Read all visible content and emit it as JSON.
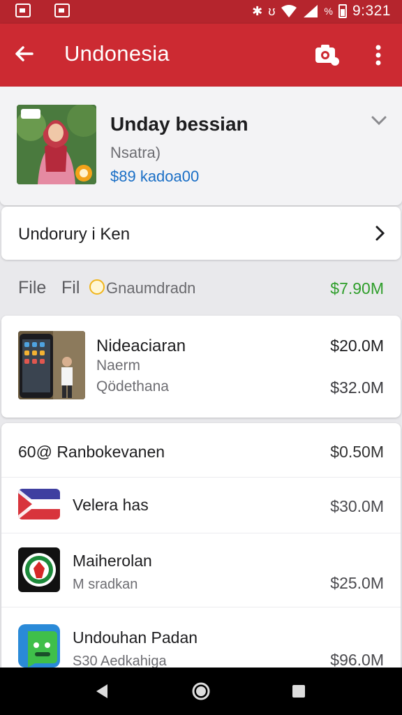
{
  "status_bar": {
    "time": "9:321",
    "icons": [
      "gallery-icon",
      "bag-icon",
      "bluetooth-icon",
      "vibrate-icon",
      "wifi-icon",
      "signal-icon",
      "battery-icon"
    ]
  },
  "app_bar": {
    "title": "Undonesia",
    "actions": [
      "camera-icon",
      "more-vert-icon"
    ]
  },
  "profile": {
    "name": "Unday bessian",
    "subtitle": "Nsatra)",
    "balance": "$89 kadoa00"
  },
  "link_row": {
    "label": "Undorury i Ken"
  },
  "summary": {
    "label1": "File",
    "label2": "Fil",
    "label3": "Gnaumdradn",
    "amount": "$7.90M",
    "amount_color": "#2f9e2b"
  },
  "featured": {
    "title": "Nideaciaran",
    "subtitle1": "Naerm",
    "subtitle2": "Qödethana",
    "amount1": "$20.0M",
    "amount2": "$32.0M"
  },
  "list": {
    "header": {
      "label": "60@ Ranbokevanen",
      "amount": "$0.50M"
    },
    "items": [
      {
        "title": "Velera has",
        "subtitle": "",
        "amount": "$30.0M",
        "icon": "flag-icon"
      },
      {
        "title": "Maiherolan",
        "subtitle": "M sradkan",
        "amount": "$25.0M",
        "icon": "emblem-icon"
      },
      {
        "title": "Undouhan Padan",
        "subtitle": "S30 Aedkahiga",
        "amount": "$96.0M",
        "icon": "app-icon"
      }
    ]
  },
  "nav": {
    "back": "back-nav-icon",
    "home": "home-nav-icon",
    "recents": "recents-nav-icon"
  },
  "colors": {
    "primary": "#cc2a32",
    "status_bar": "#b5252d",
    "link": "#1a6fc6"
  }
}
